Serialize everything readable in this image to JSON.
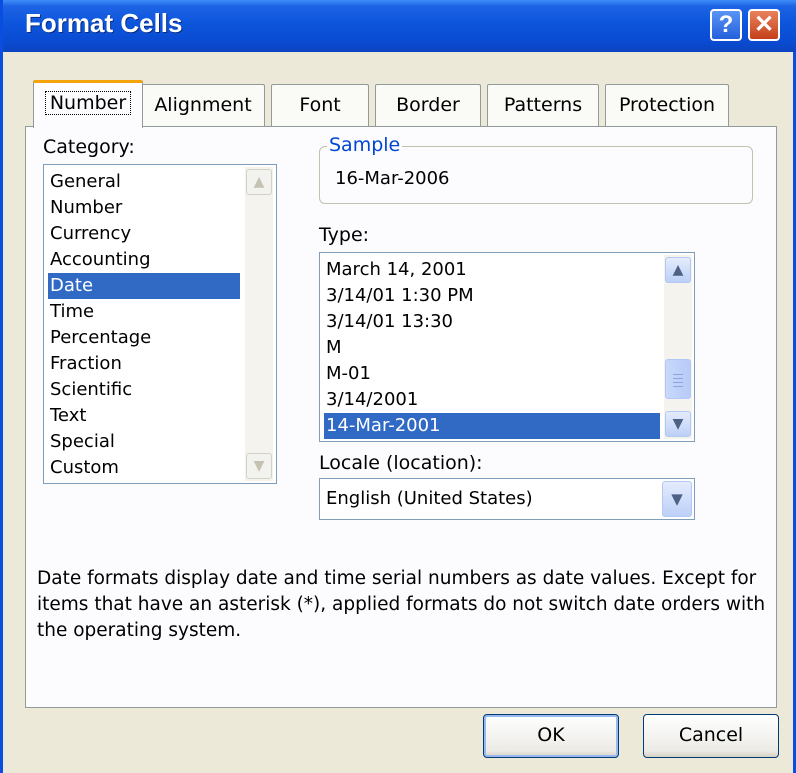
{
  "window": {
    "title": "Format Cells",
    "help_label": "?",
    "close_label": "✕"
  },
  "tabs": [
    "Number",
    "Alignment",
    "Font",
    "Border",
    "Patterns",
    "Protection"
  ],
  "category": {
    "label": "Category:",
    "items": [
      "General",
      "Number",
      "Currency",
      "Accounting",
      "Date",
      "Time",
      "Percentage",
      "Fraction",
      "Scientific",
      "Text",
      "Special",
      "Custom"
    ],
    "selected": "Date"
  },
  "sample": {
    "label": "Sample",
    "value": "16-Mar-2006"
  },
  "type": {
    "label": "Type:",
    "items": [
      "March 14, 2001",
      "3/14/01 1:30 PM",
      "3/14/01 13:30",
      "M",
      "M-01",
      "3/14/2001",
      "14-Mar-2001"
    ],
    "selected": "14-Mar-2001"
  },
  "locale": {
    "label": "Locale (location):",
    "value": "English (United States)"
  },
  "description": "Date formats display date and time serial numbers as date values.  Except for items that have an asterisk (*), applied formats do not switch date orders with the operating system.",
  "buttons": {
    "ok": "OK",
    "cancel": "Cancel"
  },
  "icons": {
    "scroll_up": "scroll-up-arrow-icon",
    "scroll_down": "scroll-down-arrow-icon",
    "dropdown": "chevron-down-icon"
  }
}
